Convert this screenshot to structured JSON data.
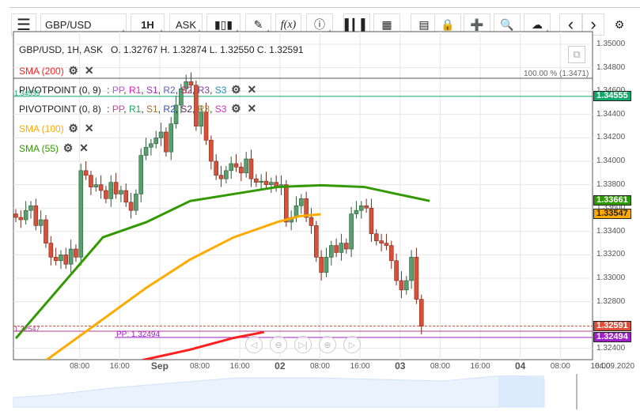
{
  "toolbar": {
    "menu_icon": "hamburger-icon",
    "symbol": "GBP/USD",
    "interval": "1H",
    "price_type": "ASK",
    "buttons": [
      "chart-type-icon",
      "pencil-icon",
      "function-icon",
      "info-icon",
      "bar-chart-icon",
      "calendar-icon",
      "news-icon",
      "lock-icon",
      "crosshair-icon",
      "zoom-chart-icon",
      "cloud-upload-icon",
      "chevron-left-icon",
      "chevron-right-icon",
      "gear-icon"
    ],
    "fx_label": "f(x)"
  },
  "ohlc_header": "GBP/USD, 1H, ASK   O. 1.32767 H. 1.32874 L. 1.32550 C. 1.32591",
  "indicators": [
    {
      "name": "SMA (200)",
      "color": "#ff2020"
    },
    {
      "name": "PIVOTPOINT (0, 9)",
      "levels": [
        "PP",
        "R1",
        "S1",
        "R2",
        "S2",
        "R3",
        "S3"
      ],
      "colors": [
        "#c050e0",
        "#e020c0",
        "#a030c0",
        "#6060c0",
        "#c02060",
        "#8040b0",
        "#2090c0"
      ]
    },
    {
      "name": "PIVOTPOINT (0, 8)",
      "levels": [
        "PP",
        "R1",
        "S1",
        "R2",
        "S2",
        "R3",
        "S3"
      ],
      "colors": [
        "#d040a0",
        "#20a060",
        "#a07030",
        "#3050b0",
        "#603060",
        "#b08020",
        "#d030c0"
      ]
    },
    {
      "name": "SMA (100)",
      "color": "#ffaa00"
    },
    {
      "name": "SMA (55)",
      "color": "#339900"
    }
  ],
  "y_axis": [
    "1.35000",
    "1.34800",
    "1.34600",
    "1.34400",
    "1.34200",
    "1.34000",
    "1.33800",
    "1.33600",
    "1.33400",
    "1.33200",
    "1.33000",
    "1.32800",
    "1.32400"
  ],
  "price_labels": [
    {
      "value": "1.34555",
      "price": 1.34555,
      "color": "#13a86b"
    },
    {
      "value": "1.33661",
      "price": 1.33661,
      "color": "#2e9900"
    },
    {
      "value": "1.33547",
      "price": 1.33547,
      "color": "#ffaa00"
    },
    {
      "value": "1.32591",
      "price": 1.32591,
      "color": "#d9503a"
    },
    {
      "value": "1.32494",
      "price": 1.32494,
      "color": "#a020c8"
    }
  ],
  "percent_label": "100.00 % (1.3471)",
  "left_labels": {
    "top": "1.34555",
    "bottom": "1.32547"
  },
  "pp_label": "PP: 1.32494",
  "x_axis": [
    {
      "t": "08:00",
      "h": 8
    },
    {
      "t": "16:00",
      "h": 16
    },
    {
      "t": "Sep",
      "h": 24,
      "b": true
    },
    {
      "t": "08:00",
      "h": 32
    },
    {
      "t": "16:00",
      "h": 40
    },
    {
      "t": "02",
      "h": 48,
      "b": true
    },
    {
      "t": "08:00",
      "h": 56
    },
    {
      "t": "16:00",
      "h": 64
    },
    {
      "t": "03",
      "h": 72,
      "b": true
    },
    {
      "t": "08:00",
      "h": 80
    },
    {
      "t": "16:00",
      "h": 88
    },
    {
      "t": "04",
      "h": 96,
      "b": true
    },
    {
      "t": "08:00",
      "h": 104
    },
    {
      "t": "16:00",
      "h": 112
    }
  ],
  "x_axis_date": "04.09.2020",
  "chart_data": {
    "type": "candlestick",
    "open_first": 1.3355,
    "closes": [
      1.3352,
      1.335,
      1.3358,
      1.3362,
      1.3345,
      1.335,
      1.333,
      1.3318,
      1.3315,
      1.332,
      1.3312,
      1.3325,
      1.3318,
      1.3392,
      1.3388,
      1.3378,
      1.338,
      1.3375,
      1.3368,
      1.3382,
      1.3372,
      1.3375,
      1.3365,
      1.3358,
      1.3372,
      1.3405,
      1.3412,
      1.3415,
      1.342,
      1.3425,
      1.3408,
      1.3432,
      1.3448,
      1.3462,
      1.3468,
      1.3465,
      1.343,
      1.3442,
      1.3418,
      1.34,
      1.3388,
      1.3385,
      1.3392,
      1.3398,
      1.3395,
      1.339,
      1.3402,
      1.3385,
      1.3382,
      1.3383,
      1.338,
      1.3382,
      1.3378,
      1.338,
      1.3348,
      1.3352,
      1.3362,
      1.3368,
      1.3352,
      1.3345,
      1.3318,
      1.3305,
      1.3318,
      1.3328,
      1.3322,
      1.333,
      1.3325,
      1.3355,
      1.3358,
      1.3362,
      1.336,
      1.3338,
      1.3332,
      1.333,
      1.3328,
      1.3315,
      1.3298,
      1.329,
      1.3298,
      1.3318,
      1.3282,
      1.3259
    ],
    "sma55": [
      [
        0,
        1.32486
      ],
      [
        40,
        1.3335
      ],
      [
        60,
        1.3348
      ],
      [
        80,
        1.3366
      ],
      [
        100,
        1.3372
      ],
      [
        120,
        1.3378
      ],
      [
        140,
        1.33795
      ],
      [
        160,
        1.3378
      ],
      [
        180,
        1.337
      ],
      [
        190,
        1.33661
      ]
    ],
    "sma100": [
      [
        14,
        1.323
      ],
      [
        40,
        1.3265
      ],
      [
        60,
        1.3292
      ],
      [
        80,
        1.3316
      ],
      [
        100,
        1.3335
      ],
      [
        120,
        1.3348
      ],
      [
        130,
        1.3353
      ],
      [
        140,
        1.33547
      ]
    ],
    "sma200": [
      [
        58,
        1.323
      ],
      [
        80,
        1.3239
      ],
      [
        100,
        1.3249
      ],
      [
        114,
        1.3254
      ]
    ],
    "ylim": [
      1.3237,
      1.351
    ]
  }
}
